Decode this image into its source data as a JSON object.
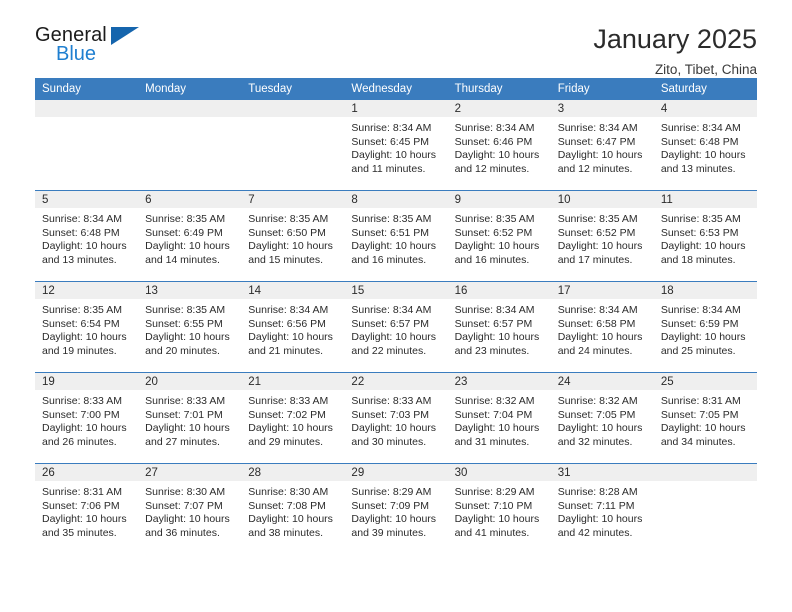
{
  "brand": {
    "name_part1": "General",
    "name_part2": "Blue",
    "triangle_icon": "triangle-icon",
    "accent_color": "#1f7fd0",
    "triangle_color": "#1565ad"
  },
  "header": {
    "title": "January 2025",
    "location": "Zito, Tibet, China"
  },
  "theme": {
    "header_blue": "#3a7cbe",
    "daynum_gray": "#efefef",
    "text_color": "#2b2b2b"
  },
  "weekday_headers": [
    "Sunday",
    "Monday",
    "Tuesday",
    "Wednesday",
    "Thursday",
    "Friday",
    "Saturday"
  ],
  "labels": {
    "sunrise": "Sunrise:",
    "sunset": "Sunset:",
    "daylight": "Daylight:"
  },
  "weeks": [
    [
      {
        "day": "",
        "sunrise": "",
        "sunset": "",
        "daylight_line1": "",
        "daylight_line2": ""
      },
      {
        "day": "",
        "sunrise": "",
        "sunset": "",
        "daylight_line1": "",
        "daylight_line2": ""
      },
      {
        "day": "",
        "sunrise": "",
        "sunset": "",
        "daylight_line1": "",
        "daylight_line2": ""
      },
      {
        "day": "1",
        "sunrise": "Sunrise: 8:34 AM",
        "sunset": "Sunset: 6:45 PM",
        "daylight_line1": "Daylight: 10 hours",
        "daylight_line2": "and 11 minutes."
      },
      {
        "day": "2",
        "sunrise": "Sunrise: 8:34 AM",
        "sunset": "Sunset: 6:46 PM",
        "daylight_line1": "Daylight: 10 hours",
        "daylight_line2": "and 12 minutes."
      },
      {
        "day": "3",
        "sunrise": "Sunrise: 8:34 AM",
        "sunset": "Sunset: 6:47 PM",
        "daylight_line1": "Daylight: 10 hours",
        "daylight_line2": "and 12 minutes."
      },
      {
        "day": "4",
        "sunrise": "Sunrise: 8:34 AM",
        "sunset": "Sunset: 6:48 PM",
        "daylight_line1": "Daylight: 10 hours",
        "daylight_line2": "and 13 minutes."
      }
    ],
    [
      {
        "day": "5",
        "sunrise": "Sunrise: 8:34 AM",
        "sunset": "Sunset: 6:48 PM",
        "daylight_line1": "Daylight: 10 hours",
        "daylight_line2": "and 13 minutes."
      },
      {
        "day": "6",
        "sunrise": "Sunrise: 8:35 AM",
        "sunset": "Sunset: 6:49 PM",
        "daylight_line1": "Daylight: 10 hours",
        "daylight_line2": "and 14 minutes."
      },
      {
        "day": "7",
        "sunrise": "Sunrise: 8:35 AM",
        "sunset": "Sunset: 6:50 PM",
        "daylight_line1": "Daylight: 10 hours",
        "daylight_line2": "and 15 minutes."
      },
      {
        "day": "8",
        "sunrise": "Sunrise: 8:35 AM",
        "sunset": "Sunset: 6:51 PM",
        "daylight_line1": "Daylight: 10 hours",
        "daylight_line2": "and 16 minutes."
      },
      {
        "day": "9",
        "sunrise": "Sunrise: 8:35 AM",
        "sunset": "Sunset: 6:52 PM",
        "daylight_line1": "Daylight: 10 hours",
        "daylight_line2": "and 16 minutes."
      },
      {
        "day": "10",
        "sunrise": "Sunrise: 8:35 AM",
        "sunset": "Sunset: 6:52 PM",
        "daylight_line1": "Daylight: 10 hours",
        "daylight_line2": "and 17 minutes."
      },
      {
        "day": "11",
        "sunrise": "Sunrise: 8:35 AM",
        "sunset": "Sunset: 6:53 PM",
        "daylight_line1": "Daylight: 10 hours",
        "daylight_line2": "and 18 minutes."
      }
    ],
    [
      {
        "day": "12",
        "sunrise": "Sunrise: 8:35 AM",
        "sunset": "Sunset: 6:54 PM",
        "daylight_line1": "Daylight: 10 hours",
        "daylight_line2": "and 19 minutes."
      },
      {
        "day": "13",
        "sunrise": "Sunrise: 8:35 AM",
        "sunset": "Sunset: 6:55 PM",
        "daylight_line1": "Daylight: 10 hours",
        "daylight_line2": "and 20 minutes."
      },
      {
        "day": "14",
        "sunrise": "Sunrise: 8:34 AM",
        "sunset": "Sunset: 6:56 PM",
        "daylight_line1": "Daylight: 10 hours",
        "daylight_line2": "and 21 minutes."
      },
      {
        "day": "15",
        "sunrise": "Sunrise: 8:34 AM",
        "sunset": "Sunset: 6:57 PM",
        "daylight_line1": "Daylight: 10 hours",
        "daylight_line2": "and 22 minutes."
      },
      {
        "day": "16",
        "sunrise": "Sunrise: 8:34 AM",
        "sunset": "Sunset: 6:57 PM",
        "daylight_line1": "Daylight: 10 hours",
        "daylight_line2": "and 23 minutes."
      },
      {
        "day": "17",
        "sunrise": "Sunrise: 8:34 AM",
        "sunset": "Sunset: 6:58 PM",
        "daylight_line1": "Daylight: 10 hours",
        "daylight_line2": "and 24 minutes."
      },
      {
        "day": "18",
        "sunrise": "Sunrise: 8:34 AM",
        "sunset": "Sunset: 6:59 PM",
        "daylight_line1": "Daylight: 10 hours",
        "daylight_line2": "and 25 minutes."
      }
    ],
    [
      {
        "day": "19",
        "sunrise": "Sunrise: 8:33 AM",
        "sunset": "Sunset: 7:00 PM",
        "daylight_line1": "Daylight: 10 hours",
        "daylight_line2": "and 26 minutes."
      },
      {
        "day": "20",
        "sunrise": "Sunrise: 8:33 AM",
        "sunset": "Sunset: 7:01 PM",
        "daylight_line1": "Daylight: 10 hours",
        "daylight_line2": "and 27 minutes."
      },
      {
        "day": "21",
        "sunrise": "Sunrise: 8:33 AM",
        "sunset": "Sunset: 7:02 PM",
        "daylight_line1": "Daylight: 10 hours",
        "daylight_line2": "and 29 minutes."
      },
      {
        "day": "22",
        "sunrise": "Sunrise: 8:33 AM",
        "sunset": "Sunset: 7:03 PM",
        "daylight_line1": "Daylight: 10 hours",
        "daylight_line2": "and 30 minutes."
      },
      {
        "day": "23",
        "sunrise": "Sunrise: 8:32 AM",
        "sunset": "Sunset: 7:04 PM",
        "daylight_line1": "Daylight: 10 hours",
        "daylight_line2": "and 31 minutes."
      },
      {
        "day": "24",
        "sunrise": "Sunrise: 8:32 AM",
        "sunset": "Sunset: 7:05 PM",
        "daylight_line1": "Daylight: 10 hours",
        "daylight_line2": "and 32 minutes."
      },
      {
        "day": "25",
        "sunrise": "Sunrise: 8:31 AM",
        "sunset": "Sunset: 7:05 PM",
        "daylight_line1": "Daylight: 10 hours",
        "daylight_line2": "and 34 minutes."
      }
    ],
    [
      {
        "day": "26",
        "sunrise": "Sunrise: 8:31 AM",
        "sunset": "Sunset: 7:06 PM",
        "daylight_line1": "Daylight: 10 hours",
        "daylight_line2": "and 35 minutes."
      },
      {
        "day": "27",
        "sunrise": "Sunrise: 8:30 AM",
        "sunset": "Sunset: 7:07 PM",
        "daylight_line1": "Daylight: 10 hours",
        "daylight_line2": "and 36 minutes."
      },
      {
        "day": "28",
        "sunrise": "Sunrise: 8:30 AM",
        "sunset": "Sunset: 7:08 PM",
        "daylight_line1": "Daylight: 10 hours",
        "daylight_line2": "and 38 minutes."
      },
      {
        "day": "29",
        "sunrise": "Sunrise: 8:29 AM",
        "sunset": "Sunset: 7:09 PM",
        "daylight_line1": "Daylight: 10 hours",
        "daylight_line2": "and 39 minutes."
      },
      {
        "day": "30",
        "sunrise": "Sunrise: 8:29 AM",
        "sunset": "Sunset: 7:10 PM",
        "daylight_line1": "Daylight: 10 hours",
        "daylight_line2": "and 41 minutes."
      },
      {
        "day": "31",
        "sunrise": "Sunrise: 8:28 AM",
        "sunset": "Sunset: 7:11 PM",
        "daylight_line1": "Daylight: 10 hours",
        "daylight_line2": "and 42 minutes."
      },
      {
        "day": "",
        "sunrise": "",
        "sunset": "",
        "daylight_line1": "",
        "daylight_line2": ""
      }
    ]
  ]
}
